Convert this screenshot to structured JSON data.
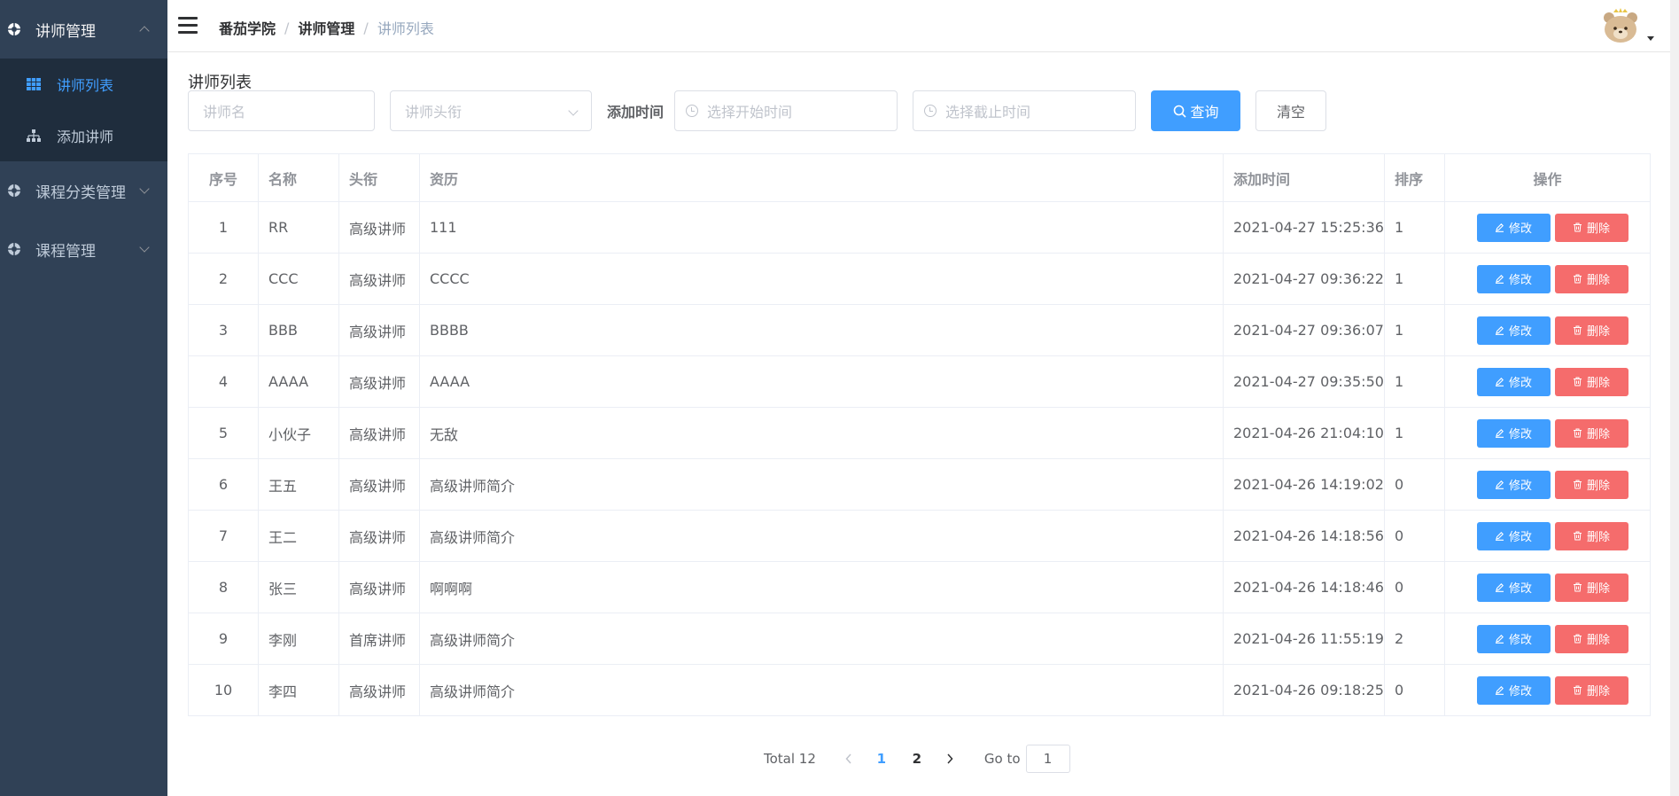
{
  "sidebar": {
    "groups": [
      {
        "label": "讲师管理",
        "expanded": true,
        "items": [
          {
            "label": "讲师列表",
            "active": true
          },
          {
            "label": "添加讲师",
            "active": false
          }
        ]
      },
      {
        "label": "课程分类管理",
        "expanded": false
      },
      {
        "label": "课程管理",
        "expanded": false
      }
    ]
  },
  "navbar": {
    "breadcrumb": [
      "番茄学院",
      "讲师管理",
      "讲师列表"
    ]
  },
  "page": {
    "title": "讲师列表"
  },
  "filters": {
    "name_placeholder": "讲师名",
    "level_placeholder": "讲师头衔",
    "time_label": "添加时间",
    "start_placeholder": "选择开始时间",
    "end_placeholder": "选择截止时间",
    "query_label": "查询",
    "clear_label": "清空"
  },
  "table": {
    "headers": [
      "序号",
      "名称",
      "头衔",
      "资历",
      "添加时间",
      "排序",
      "操作"
    ],
    "edit_label": "修改",
    "delete_label": "删除",
    "rows": [
      {
        "no": "1",
        "name": "RR",
        "level": "高级讲师",
        "intro": "111",
        "time": "2021-04-27 15:25:36",
        "sort": "1"
      },
      {
        "no": "2",
        "name": "CCC",
        "level": "高级讲师",
        "intro": "CCCC",
        "time": "2021-04-27 09:36:22",
        "sort": "1"
      },
      {
        "no": "3",
        "name": "BBB",
        "level": "高级讲师",
        "intro": "BBBB",
        "time": "2021-04-27 09:36:07",
        "sort": "1"
      },
      {
        "no": "4",
        "name": "AAAA",
        "level": "高级讲师",
        "intro": "AAAA",
        "time": "2021-04-27 09:35:50",
        "sort": "1"
      },
      {
        "no": "5",
        "name": "小伙子",
        "level": "高级讲师",
        "intro": "无敌",
        "time": "2021-04-26 21:04:10",
        "sort": "1"
      },
      {
        "no": "6",
        "name": "王五",
        "level": "高级讲师",
        "intro": "高级讲师简介",
        "time": "2021-04-26 14:19:02",
        "sort": "0"
      },
      {
        "no": "7",
        "name": "王二",
        "level": "高级讲师",
        "intro": "高级讲师简介",
        "time": "2021-04-26 14:18:56",
        "sort": "0"
      },
      {
        "no": "8",
        "name": "张三",
        "level": "高级讲师",
        "intro": "啊啊啊",
        "time": "2021-04-26 14:18:46",
        "sort": "0"
      },
      {
        "no": "9",
        "name": "李刚",
        "level": "首席讲师",
        "intro": "高级讲师简介",
        "time": "2021-04-26 11:55:19",
        "sort": "2"
      },
      {
        "no": "10",
        "name": "李四",
        "level": "高级讲师",
        "intro": "高级讲师简介",
        "time": "2021-04-26 09:18:25",
        "sort": "0"
      }
    ]
  },
  "pagination": {
    "total_text": "Total 12",
    "pages": [
      "1",
      "2"
    ],
    "current_page": "1",
    "goto_label": "Go to",
    "goto_value": "1"
  },
  "colors": {
    "sidebar_bg": "#304156",
    "submenu_bg": "#1f2d3d",
    "primary": "#409eff",
    "danger": "#f56c6c"
  },
  "icons": {
    "menu_group": "aperture-icon",
    "list": "grid-icon",
    "add": "tree-icon",
    "search": "search-icon",
    "edit": "pencil-icon",
    "delete": "trash-icon",
    "clock": "clock-icon"
  }
}
